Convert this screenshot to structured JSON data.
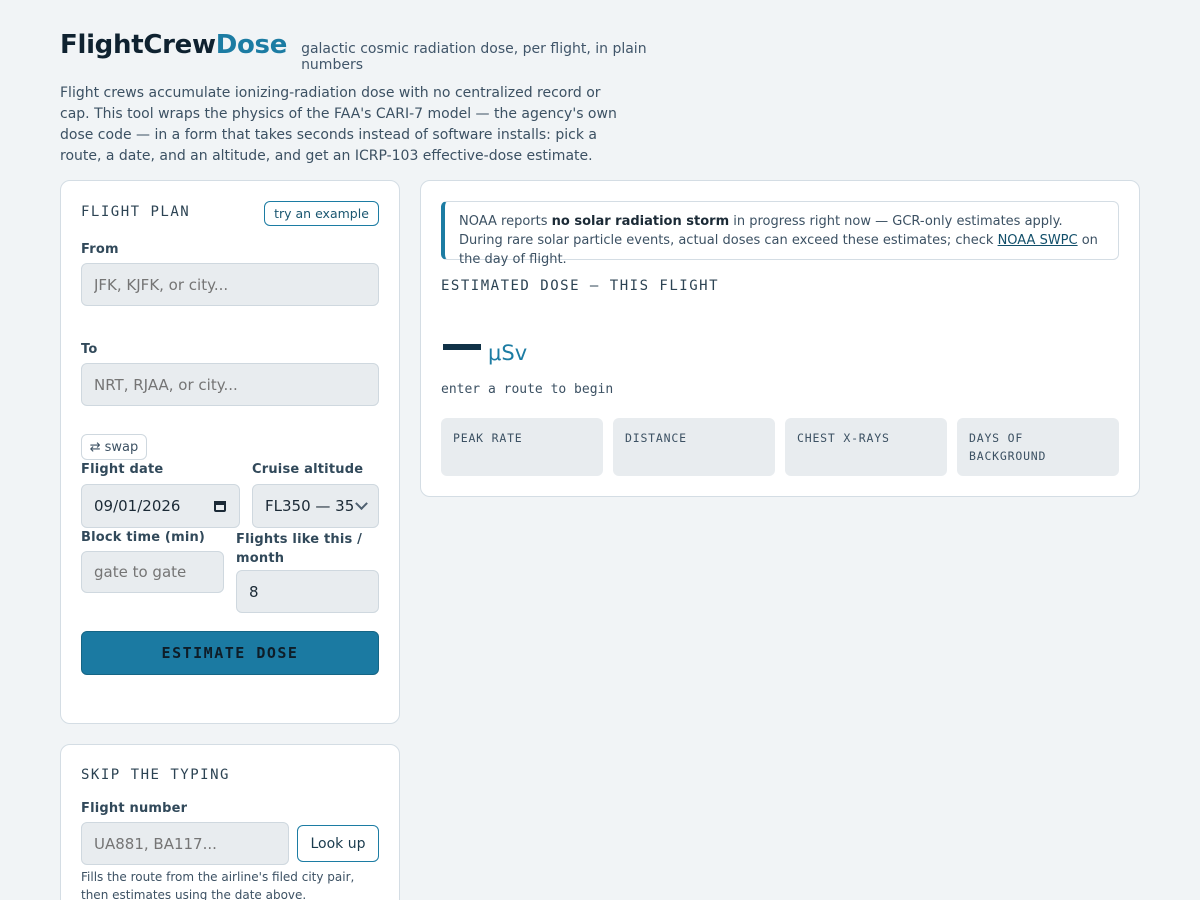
{
  "header": {
    "brand_part1": "FlightCrew",
    "brand_part2": "Dose",
    "tagline": "galactic cosmic radiation dose, per flight, in plain numbers",
    "intro": "Flight crews accumulate ionizing-radiation dose with no centralized record or cap. This tool wraps the physics of the FAA's CARI-7 model — the agency's own dose code — in a form that takes seconds instead of software installs: pick a route, a date, and an altitude, and get an ICRP-103 effective-dose estimate."
  },
  "flight_plan": {
    "title": "FLIGHT PLAN",
    "example_button": "try an example",
    "from_label": "From",
    "from_placeholder": "JFK, KJFK, or city...",
    "to_label": "To",
    "to_placeholder": "NRT, RJAA, or city...",
    "swap_label": "swap",
    "date_label": "Flight date",
    "date_value": "09/01/2026",
    "altitude_label": "Cruise altitude",
    "altitude_value": "FL350 — 35",
    "block_label": "Block time (min)",
    "block_placeholder": "gate to gate",
    "flights_label": "Flights like this / month",
    "flights_value": "8",
    "estimate_button": "ESTIMATE DOSE"
  },
  "skip": {
    "title": "SKIP THE TYPING",
    "flight_number_label": "Flight number",
    "flight_number_placeholder": "UA881, BA117...",
    "lookup_button": "Look up",
    "help": "Fills the route from the airline's filed city pair, then estimates using the date above."
  },
  "result": {
    "notice_pre": "NOAA reports ",
    "notice_bold": "no solar radiation storm",
    "notice_mid": " in progress right now — GCR-only estimates apply. During rare solar particle events, actual doses can exceed these estimates; check ",
    "notice_link": "NOAA SWPC",
    "notice_post": " on the day of flight.",
    "title": "ESTIMATED DOSE — THIS FLIGHT",
    "unit": "μSv",
    "hint": "enter a route to begin",
    "stats": [
      "PEAK RATE",
      "DISTANCE",
      "CHEST X-RAYS",
      "DAYS OF BACKGROUND"
    ]
  },
  "colors": {
    "accent": "#1c7ca3",
    "background": "#f1f4f6",
    "card": "#ffffff"
  },
  "icons": {
    "swap": "swap-arrows-icon",
    "calendar": "calendar-icon",
    "select": "chevron-down-icon"
  }
}
